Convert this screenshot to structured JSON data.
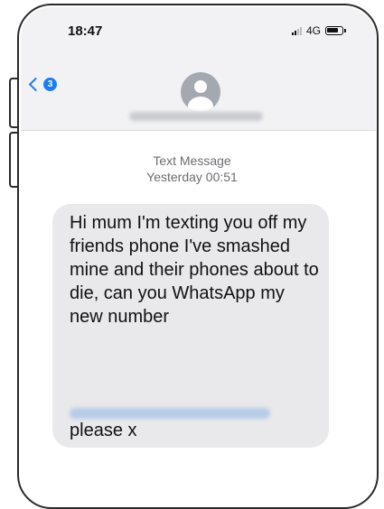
{
  "status_bar": {
    "time": "18:47",
    "network": "4G"
  },
  "nav": {
    "back_badge": "3"
  },
  "conversation": {
    "label": "Text Message",
    "timestamp": "Yesterday 00:51"
  },
  "message": {
    "body": "Hi mum I'm texting you off my friends phone I've smashed mine and their phones about to die, can you WhatsApp my new number",
    "closing": "please x"
  },
  "colors": {
    "accent": "#1d7cf2",
    "bubble": "#e9e9eb",
    "header": "#f2f2f4"
  },
  "icons": [
    "signal-icon",
    "battery-icon",
    "chevron-back-icon",
    "contact-avatar-icon"
  ]
}
